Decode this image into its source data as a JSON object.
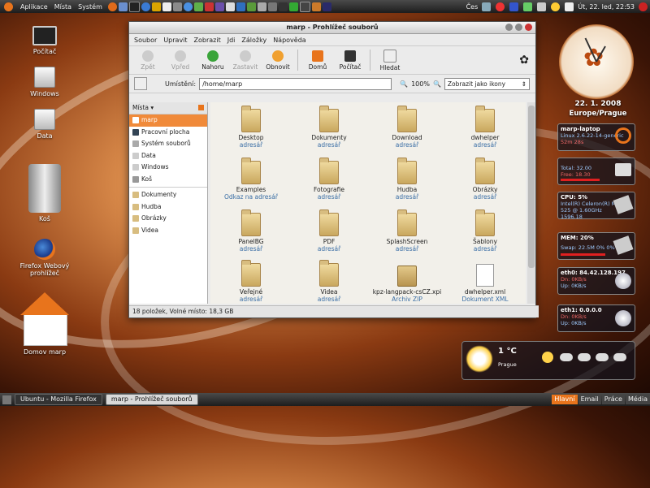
{
  "top_panel": {
    "menus": [
      "Aplikace",
      "Místa",
      "Systém"
    ],
    "keyboard_layout": "Čes",
    "datetime": "Út, 22. led, 22:53"
  },
  "desktop_icons": [
    "Počítač",
    "Windows",
    "Data",
    "Koš",
    "Firefox Webový prohlížeč",
    "Domov marp"
  ],
  "window": {
    "title": "marp - Prohlížeč souborů",
    "menubar": [
      "Soubor",
      "Upravit",
      "Zobrazit",
      "Jdi",
      "Záložky",
      "Nápověda"
    ],
    "toolbar": {
      "back": "Zpět",
      "forward": "Vpřed",
      "up": "Nahoru",
      "stop": "Zastavit",
      "reload": "Obnovit",
      "home": "Domů",
      "computer": "Počítač",
      "search": "Hledat"
    },
    "location_label": "Umístění:",
    "location_value": "/home/marp",
    "zoom": "100%",
    "view_mode": "Zobrazit jako ikony",
    "sidebar": {
      "header": "Místa",
      "items": [
        "marp",
        "Pracovní plocha",
        "Systém souborů",
        "Data",
        "Windows",
        "Koš"
      ],
      "bookmarks": [
        "Dokumenty",
        "Hudba",
        "Obrázky",
        "Videa"
      ]
    },
    "files": [
      {
        "name": "Desktop",
        "sub": "adresář"
      },
      {
        "name": "Dokumenty",
        "sub": "adresář"
      },
      {
        "name": "Download",
        "sub": "adresář"
      },
      {
        "name": "dwhelper",
        "sub": "adresář"
      },
      {
        "name": "Examples",
        "sub": "Odkaz na adresář"
      },
      {
        "name": "Fotografie",
        "sub": "adresář"
      },
      {
        "name": "Hudba",
        "sub": "adresář"
      },
      {
        "name": "Obrázky",
        "sub": "adresář"
      },
      {
        "name": "PanelBG",
        "sub": "adresář"
      },
      {
        "name": "PDF",
        "sub": "adresář"
      },
      {
        "name": "SplashScreen",
        "sub": "adresář"
      },
      {
        "name": "Šablony",
        "sub": "adresář"
      },
      {
        "name": "Veřejné",
        "sub": "adresář"
      },
      {
        "name": "Videa",
        "sub": "adresář"
      },
      {
        "name": "kpz-langpack-csCZ.xpi",
        "sub": "Archiv ZIP"
      },
      {
        "name": "dwhelper.xml",
        "sub": "Dokument XML"
      }
    ],
    "status": "18 položek, Volné místo: 18,3 GB"
  },
  "widgets": {
    "clock_date": "22. 1. 2008",
    "clock_location": "Europe/Prague",
    "sysinfo": [
      {
        "title": "marp-laptop",
        "lines": [
          "Linux 2.6.22-14-generic",
          "52m 28s"
        ]
      },
      {
        "title": "",
        "lines": [
          "Total: 32.00",
          "Free: 18.30"
        ]
      },
      {
        "title": "CPU: 5%",
        "lines": [
          "Intel(R) Celeron(R) M CPU",
          "525 @ 1.60GHz",
          "1596.18"
        ]
      },
      {
        "title": "MEM: 20%",
        "lines": [
          "Swap: 22.5M 0% 0%"
        ]
      },
      {
        "title": "eth0: 84.42.128.197",
        "lines": [
          "Dn: 0KB/s",
          "Up: 0KB/s"
        ]
      },
      {
        "title": "eth1: 0.0.0.0",
        "lines": [
          "Dn: 0KB/s",
          "Up: 0KB/s"
        ]
      }
    ],
    "weather_temp": "1 °C",
    "weather_city": "Prague"
  },
  "taskbar": {
    "tasks": [
      "Ubuntu - Mozilla Firefox",
      "marp - Prohlížeč souborů"
    ],
    "workspaces": [
      "Hlavní",
      "Email",
      "Práce",
      "Média"
    ]
  }
}
